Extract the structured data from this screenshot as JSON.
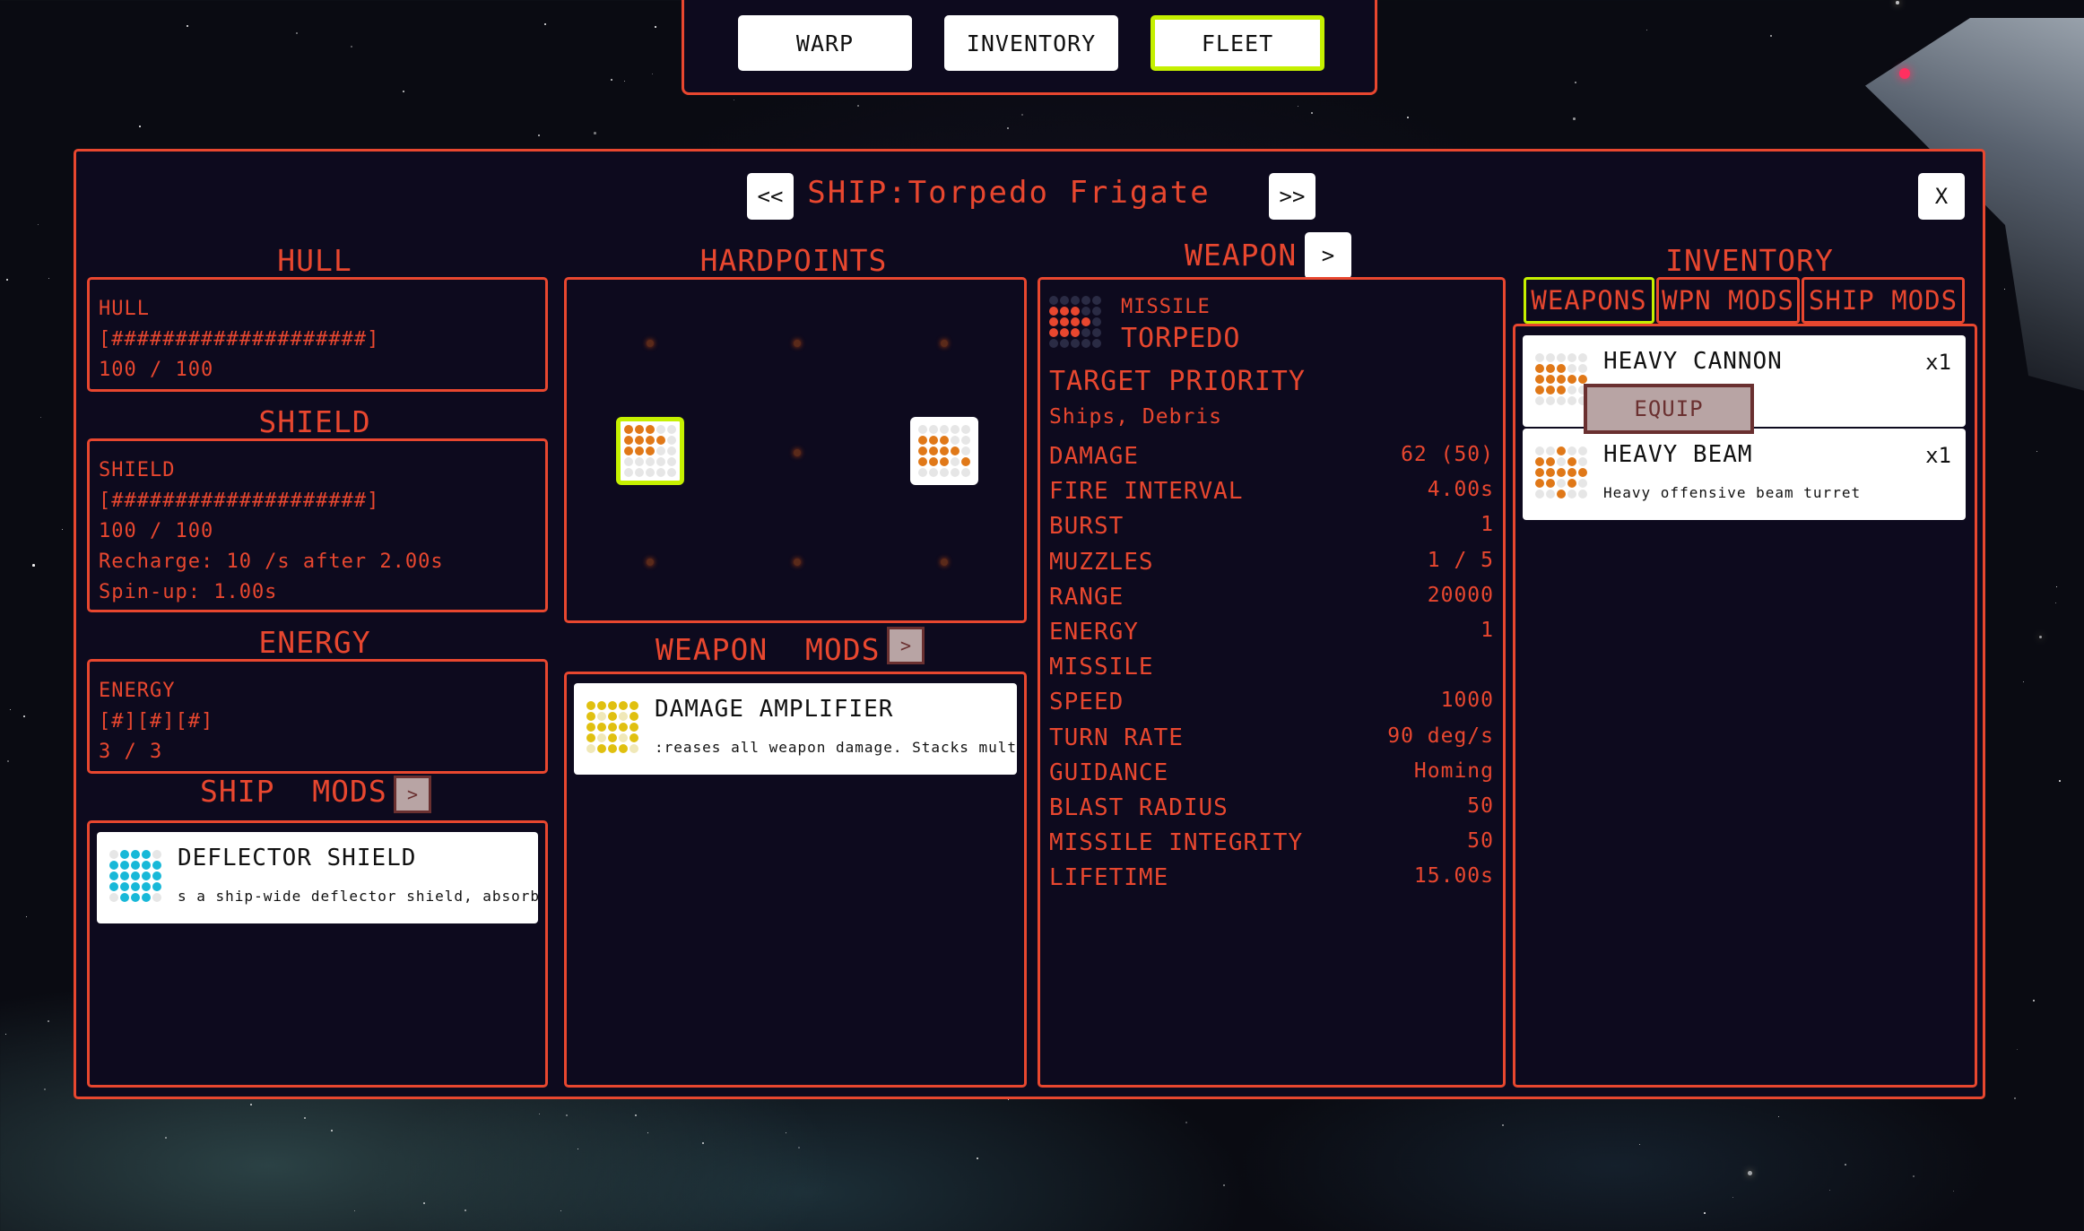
{
  "nav": {
    "warp": "WARP",
    "inventory": "INVENTORY",
    "fleet": "FLEET",
    "active": "FLEET"
  },
  "header": {
    "prev": "<<",
    "title": "SHIP:Torpedo Frigate",
    "next": ">>",
    "close": "X"
  },
  "hull": {
    "heading": "HULL",
    "label": "HULL",
    "bar": "[####################]",
    "value": "100 / 100"
  },
  "shield": {
    "heading": "SHIELD",
    "label": "SHIELD",
    "bar": "[####################]",
    "value": "100 / 100",
    "recharge": "Recharge: 10 /s after 2.00s",
    "spinup": "Spin-up: 1.00s"
  },
  "energy": {
    "heading": "ENERGY",
    "label": "ENERGY",
    "bar": "[#][#][#]",
    "value": "3 / 3"
  },
  "ship_mods": {
    "heading_a": "SHIP",
    "heading_b": "MODS",
    "toggle": ">",
    "items": [
      {
        "title": "DEFLECTOR SHIELD",
        "desc": "s a ship-wide deflector shield, absorbin",
        "icon": "shield-mod-icon"
      }
    ]
  },
  "hardpoints": {
    "heading": "HARDPOINTS"
  },
  "weapon_mods": {
    "heading_a": "WEAPON",
    "heading_b": "MODS",
    "toggle": ">",
    "items": [
      {
        "title": "DAMAGE AMPLIFIER",
        "desc": ":reases all weapon damage. Stacks multipl",
        "icon": "damage-amp-icon"
      }
    ]
  },
  "weapon": {
    "heading": "WEAPON",
    "toggle": ">",
    "type": "MISSILE",
    "name": "TORPEDO",
    "target_priority_label": "TARGET PRIORITY",
    "target_priority_value": "Ships, Debris",
    "stats": [
      {
        "label": "DAMAGE",
        "value": "62 (50)"
      },
      {
        "label": "FIRE INTERVAL",
        "value": "4.00s"
      },
      {
        "label": "BURST",
        "value": "1"
      },
      {
        "label": "MUZZLES",
        "value": "1 / 5"
      },
      {
        "label": "RANGE",
        "value": "20000"
      },
      {
        "label": "ENERGY",
        "value": "1"
      },
      {
        "label": "MISSILE",
        "value": ""
      },
      {
        "label": "SPEED",
        "value": "1000"
      },
      {
        "label": "TURN RATE",
        "value": "90 deg/s"
      },
      {
        "label": "GUIDANCE",
        "value": "Homing"
      },
      {
        "label": "BLAST RADIUS",
        "value": "50"
      },
      {
        "label": "MISSILE INTEGRITY",
        "value": "50"
      },
      {
        "label": "LIFETIME",
        "value": "15.00s"
      }
    ]
  },
  "inventory": {
    "heading": "INVENTORY",
    "tabs": [
      "WEAPONS",
      "WPN MODS",
      "SHIP MODS"
    ],
    "active_tab": "WEAPONS",
    "items": [
      {
        "title": "HEAVY CANNON",
        "count": "x1",
        "desc": "",
        "icon": "heavy-cannon-icon"
      },
      {
        "title": "HEAVY BEAM",
        "count": "x1",
        "desc": "Heavy offensive beam turret",
        "icon": "heavy-beam-icon"
      }
    ],
    "equip": "EQUIP"
  },
  "colors": {
    "accent": "#e8472f",
    "selected": "#c5f000",
    "panel_bg": "#0d0a1e",
    "icon_orange": "#e07818",
    "icon_yellow": "#e0c010",
    "icon_cyan": "#18b8d8",
    "icon_red": "#e8472f"
  }
}
